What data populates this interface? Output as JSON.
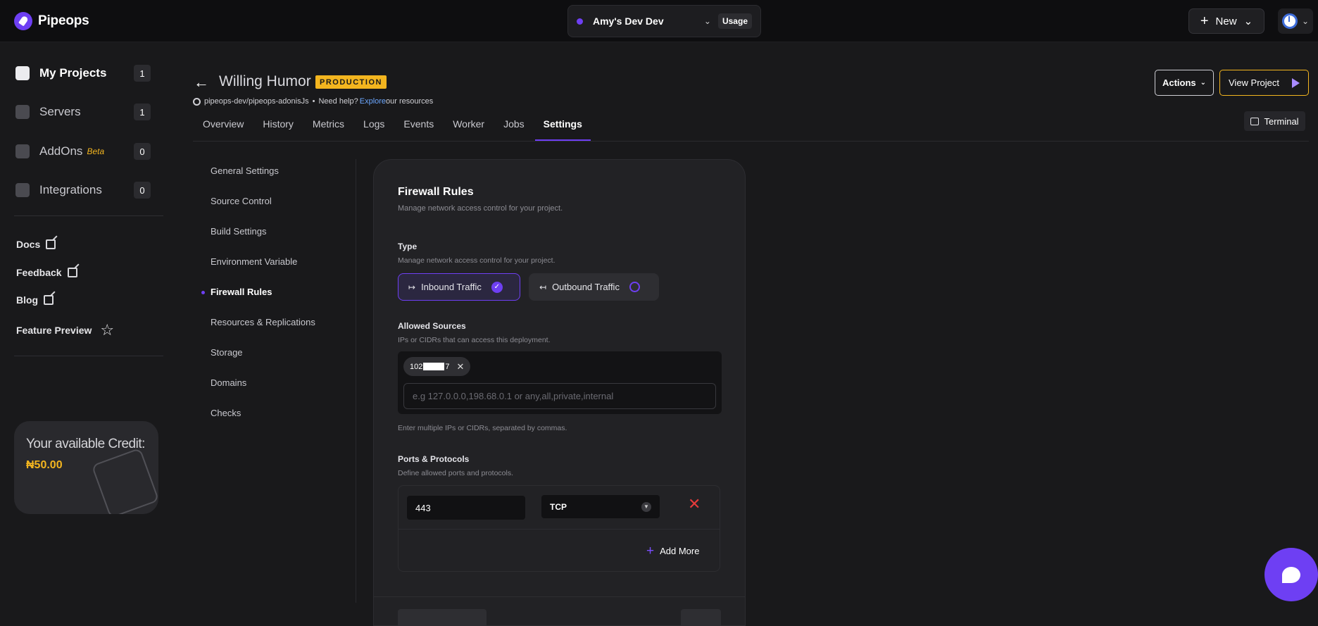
{
  "app": {
    "name": "Pipeops"
  },
  "topbar": {
    "workspace_name": "Amy's Dev Dev",
    "usage_label": "Usage",
    "new_label": "New"
  },
  "sidebar": {
    "items": [
      {
        "label": "My Projects",
        "count": "1"
      },
      {
        "label": "Servers",
        "count": "1"
      },
      {
        "label": "AddOns",
        "badge": "Beta",
        "count": "0"
      },
      {
        "label": "Integrations",
        "count": "0"
      }
    ],
    "links": [
      {
        "label": "Docs"
      },
      {
        "label": "Feedback"
      },
      {
        "label": "Blog"
      },
      {
        "label": "Feature Preview"
      }
    ],
    "credit": {
      "title": "Your available Credit:",
      "value": "₦50.00"
    }
  },
  "project": {
    "title": "Willing Humor",
    "env_badge": "PRODUCTION",
    "repo": "pipeops-dev/pipeops-adonisJs",
    "separator": "•",
    "help_prefix": "Need help?",
    "help_link": "Explore",
    "help_suffix": "our resources"
  },
  "header": {
    "actions_label": "Actions",
    "view_project_label": "View Project",
    "terminal_label": "Terminal"
  },
  "tabs": [
    {
      "label": "Overview"
    },
    {
      "label": "History"
    },
    {
      "label": "Metrics"
    },
    {
      "label": "Logs"
    },
    {
      "label": "Events"
    },
    {
      "label": "Worker"
    },
    {
      "label": "Jobs"
    },
    {
      "label": "Settings"
    }
  ],
  "settings_nav": [
    {
      "label": "General Settings"
    },
    {
      "label": "Source Control"
    },
    {
      "label": "Build Settings"
    },
    {
      "label": "Environment Variable"
    },
    {
      "label": "Firewall Rules"
    },
    {
      "label": "Resources & Replications"
    },
    {
      "label": "Storage"
    },
    {
      "label": "Domains"
    },
    {
      "label": "Checks"
    }
  ],
  "firewall": {
    "title": "Firewall Rules",
    "subtitle": "Manage network access control for your project.",
    "type_label": "Type",
    "type_sub": "Manage network access control for your project.",
    "inbound_label": "Inbound Traffic",
    "outbound_label": "Outbound Traffic",
    "selected_type": "Inbound Traffic",
    "sources_label": "Allowed Sources",
    "sources_sub": "IPs or CIDRs that can access this deployment.",
    "chip_prefix": "102",
    "chip_suffix": "7",
    "sources_placeholder": "e.g 127.0.0.0,198.68.0.1 or any,all,private,internal",
    "sources_hint": "Enter multiple IPs or CIDRs, separated by commas.",
    "ports_label": "Ports & Protocols",
    "ports_sub": "Define allowed ports and protocols.",
    "port_value": "443",
    "protocol_value": "TCP",
    "add_more_label": "Add More"
  },
  "colors": {
    "accent": "#6e3ff3",
    "badge": "#f3b51f",
    "danger": "#e63b3b"
  }
}
